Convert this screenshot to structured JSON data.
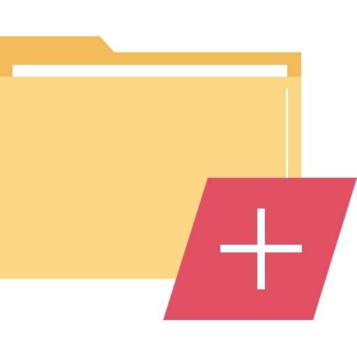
{
  "icon": {
    "name": "add-folder-icon",
    "colors": {
      "folder_tab": "#F2BB57",
      "folder_body": "#FDD784",
      "paper": "#FFFFFF",
      "badge": "#E05062",
      "plus": "#FFFFFF"
    }
  }
}
